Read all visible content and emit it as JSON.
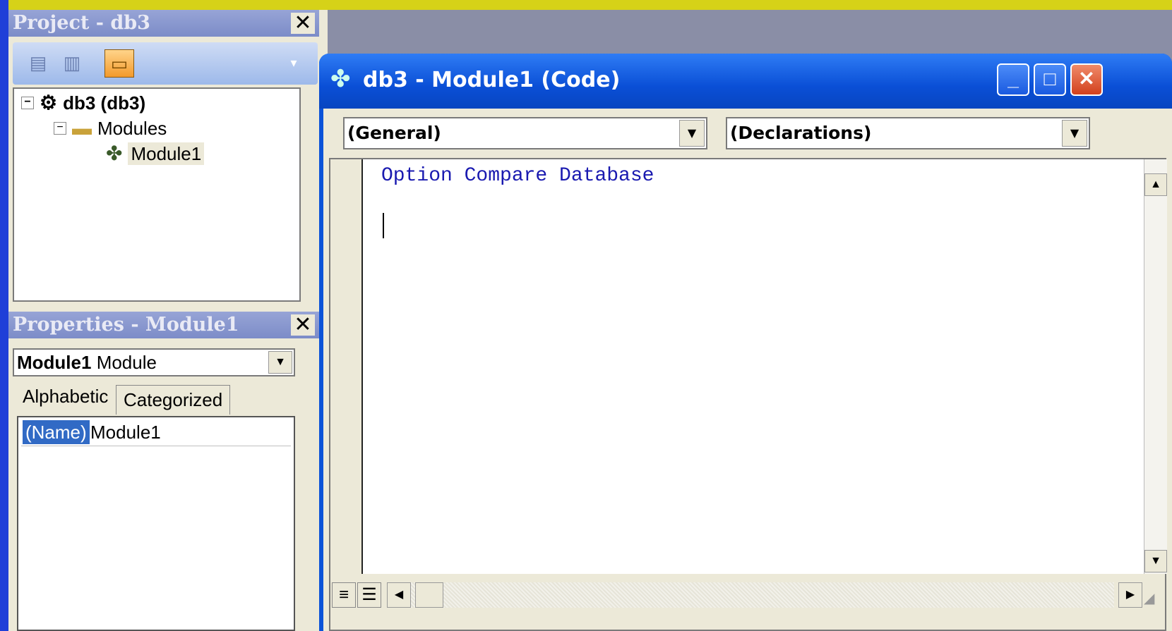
{
  "project_panel": {
    "title": "Project - db3",
    "close_label": "✕",
    "tree": {
      "root": "db3 (db3)",
      "folder": "Modules",
      "module": "Module1"
    }
  },
  "properties_panel": {
    "title": "Properties - Module1",
    "close_label": "✕",
    "object_name": "Module1",
    "object_type": "Module",
    "tabs": [
      "Alphabetic",
      "Categorized"
    ],
    "rows": [
      {
        "name": "(Name)",
        "value": "Module1"
      }
    ]
  },
  "code_window": {
    "title": "db3 - Module1 (Code)",
    "object_combo": "(General)",
    "procedure_combo": "(Declarations)",
    "code_lines": [
      "Option Compare Database"
    ]
  },
  "colors": {
    "titlebar": "#0a4fd6",
    "keyword": "#1a1ab0",
    "selection": "#316ac5"
  }
}
